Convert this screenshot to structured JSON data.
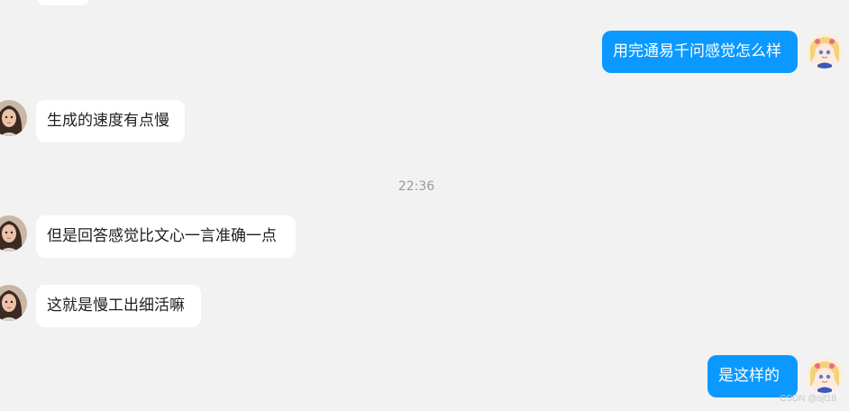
{
  "messages": [
    {
      "side": "right",
      "text": "用完通易千问感觉怎么样",
      "avatar": "anime-girl-avatar"
    },
    {
      "side": "left",
      "text": "生成的速度有点慢",
      "avatar": "woman-photo-avatar"
    },
    {
      "side": "left",
      "text": "但是回答感觉比文心一言准确一点",
      "avatar": "woman-photo-avatar"
    },
    {
      "side": "left",
      "text": "这就是慢工出细活嘛",
      "avatar": "woman-photo-avatar"
    },
    {
      "side": "right",
      "text": "是这样的",
      "avatar": "anime-girl-avatar"
    }
  ],
  "timestamp": "22:36",
  "watermark": "CSDN @ojt18",
  "colors": {
    "background": "#f2f2f2",
    "incoming_bubble": "#ffffff",
    "outgoing_bubble": "#0b99ff",
    "timestamp_text": "#9a9a9a"
  }
}
